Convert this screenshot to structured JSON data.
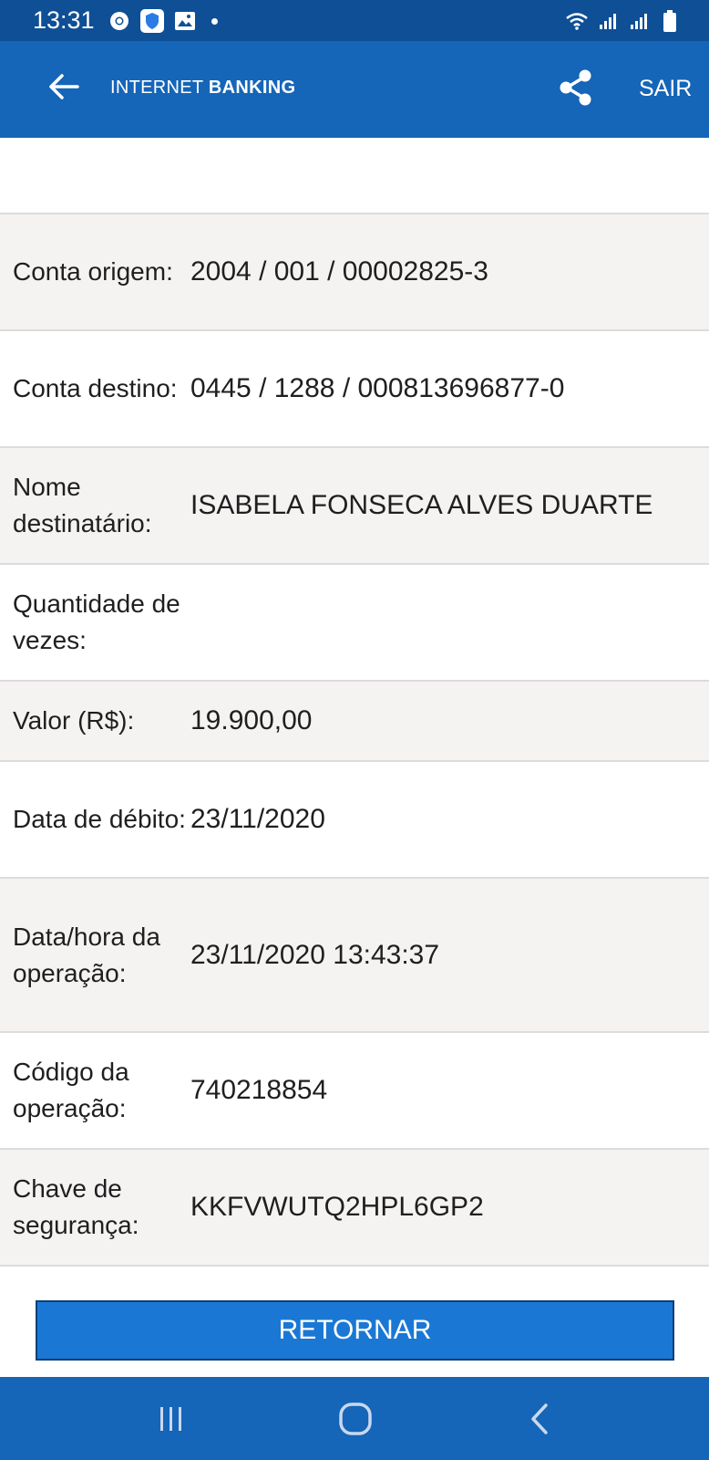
{
  "status_bar": {
    "time": "13:31",
    "left_icons": [
      "chrome-icon",
      "shield-icon",
      "image-icon",
      "dot-icon"
    ],
    "right_icons": [
      "wifi-icon",
      "signal-icon",
      "signal-icon",
      "battery-icon"
    ]
  },
  "appbar": {
    "brand_part1": "INTERNET ",
    "brand_part2": "BANKING",
    "exit_label": "SAIR",
    "icons": [
      "back-arrow-icon",
      "share-icon"
    ]
  },
  "details": [
    {
      "label": "Conta origem:",
      "value": "2004 / 001 / 00002825-3"
    },
    {
      "label": "Conta destino:",
      "value": "0445 / 1288 / 000813696877-0"
    },
    {
      "label": "Nome destinatário:",
      "value": "ISABELA FONSECA ALVES DUARTE"
    },
    {
      "label": "Quantidade de vezes:",
      "value": ""
    },
    {
      "label": "Valor (R$):",
      "value": "19.900,00"
    },
    {
      "label": "Data de débito:",
      "value": "23/11/2020"
    },
    {
      "label": "Data/hora da operação:",
      "value": "23/11/2020 13:43:37"
    },
    {
      "label": "Código da operação:",
      "value": "740218854"
    },
    {
      "label": "Chave de segurança:",
      "value": "KKFVWUTQ2HPL6GP2"
    }
  ],
  "button": {
    "label": "RETORNAR"
  },
  "navbar": {
    "icons": [
      "recents-icon",
      "home-icon",
      "back-icon"
    ]
  },
  "colors": {
    "status_bar": "#0e4f96",
    "app_bar": "#1565b8",
    "button": "#1a78d4",
    "row_alt": "#f5f2f2"
  }
}
